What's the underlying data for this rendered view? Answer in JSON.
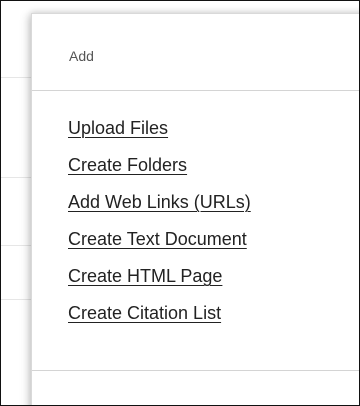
{
  "menu": {
    "title": "Add",
    "items": [
      {
        "label": "Upload Files"
      },
      {
        "label": "Create Folders"
      },
      {
        "label": "Add Web Links (URLs)"
      },
      {
        "label": "Create Text Document"
      },
      {
        "label": "Create HTML Page"
      },
      {
        "label": "Create Citation List"
      }
    ]
  }
}
